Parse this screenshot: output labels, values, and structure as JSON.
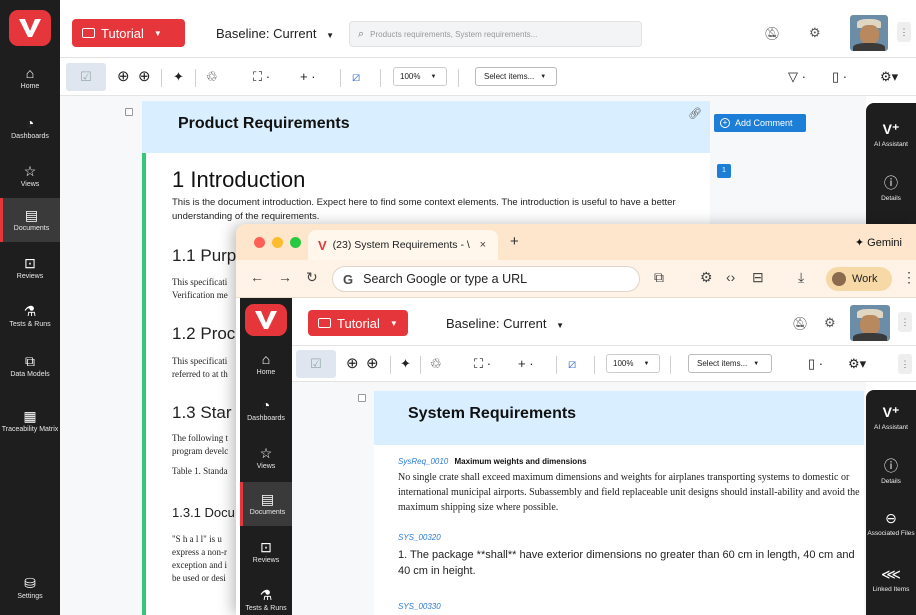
{
  "back": {
    "sidebar": [
      {
        "icon": "home-icon",
        "glyph": "⌂",
        "label": "Home"
      },
      {
        "icon": "dashboards-icon",
        "glyph": "◔",
        "label": "Dashboards"
      },
      {
        "icon": "views-icon",
        "glyph": "☆",
        "label": "Views"
      },
      {
        "icon": "documents-icon",
        "glyph": "▤",
        "label": "Documents"
      },
      {
        "icon": "reviews-icon",
        "glyph": "⊡",
        "label": "Reviews"
      },
      {
        "icon": "tests-icon",
        "glyph": "⚗",
        "label": "Tests & Runs"
      },
      {
        "icon": "data-models-icon",
        "glyph": "⧉",
        "label": "Data Models"
      },
      {
        "icon": "traceability-icon",
        "glyph": "▦",
        "label": "Traceability Matrix"
      },
      {
        "icon": "settings-icon",
        "glyph": "⛁",
        "label": "Settings"
      }
    ],
    "top": {
      "project_label": "Tutorial",
      "baseline_label": "Baseline: Current",
      "search_placeholder": "Products requirements, System requirements..."
    },
    "toolbar": {
      "zoom": "100%",
      "select_items": "Select items..."
    },
    "document": {
      "title": "Product Requirements",
      "add_comment": "Add Comment",
      "comment_count": "1",
      "h1": "1  Introduction",
      "intro": "This is the document introduction. Expect here to find some context elements. The introduction is useful to have a better understanding of the requirements.",
      "h2_purpose": "1.1  Purp",
      "purpose_text_1": "This specificati",
      "purpose_text_2": "Verification me",
      "h2_product": "1.2  Proc",
      "product_text_1": "This specificati",
      "product_text_2": "referred to at th",
      "h2_standards": "1.3  Star",
      "standards_text_1": "The following t",
      "standards_text_2": "program develc",
      "table_caption": "Table 1. Standa",
      "h3_doc": "1.3.1  Docu",
      "shall_text_1": "\"S h a l l\" is u",
      "shall_text_2": "express a non-r",
      "shall_text_3": "exception and i",
      "shall_text_4": "be used or desi"
    },
    "right_panel": [
      {
        "icon": "ai-assistant-icon",
        "glyph": "V⁺",
        "label": "AI Assistant"
      },
      {
        "icon": "details-icon",
        "glyph": "ⓘ",
        "label": "Details"
      }
    ]
  },
  "browser": {
    "tab_title": "(23) System Requirements - \\",
    "tab_close": "×",
    "new_tab": "+",
    "gemini": "✦ Gemini",
    "omnibox": "Search Google or type a URL",
    "profile": "Work",
    "app": {
      "sidebar": [
        {
          "icon": "home-icon",
          "glyph": "⌂",
          "label": "Home"
        },
        {
          "icon": "dashboards-icon",
          "glyph": "◔",
          "label": "Dashboards"
        },
        {
          "icon": "views-icon",
          "glyph": "☆",
          "label": "Views"
        },
        {
          "icon": "documents-icon",
          "glyph": "▤",
          "label": "Documents"
        },
        {
          "icon": "reviews-icon",
          "glyph": "⊡",
          "label": "Reviews"
        },
        {
          "icon": "tests-icon",
          "glyph": "⚗",
          "label": "Tests & Runs"
        }
      ],
      "top": {
        "project_label": "Tutorial",
        "baseline_label": "Baseline: Current"
      },
      "toolbar": {
        "zoom": "100%",
        "select_items": "Select items..."
      },
      "document": {
        "title": "System Requirements",
        "req1_id": "SysReq_0010",
        "req1_name": "Maximum weights and dimensions",
        "req1_text": "No single crate shall exceed maximum dimensions and weights for airplanes transporting systems to domestic or international municipal airports.  Subassembly and field replaceable unit designs should install-ability and avoid the maximum shipping size where possible.",
        "req2_id": "SYS_00320",
        "req2_text": "1. The package **shall** have exterior dimensions no greater than 60 cm in length, 40 cm and 40 cm in height.",
        "req3_id": "SYS_00330"
      },
      "right_panel": [
        {
          "icon": "ai-assistant-icon",
          "glyph": "V⁺",
          "label": "AI Assistant"
        },
        {
          "icon": "details-icon",
          "glyph": "ⓘ",
          "label": "Details"
        },
        {
          "icon": "attachment-icon",
          "glyph": "⊖",
          "label": "Associated Files"
        },
        {
          "icon": "linked-items-icon",
          "glyph": "⋘",
          "label": "Linked Items"
        }
      ]
    }
  },
  "colors": {
    "brand_red": "#e5373b",
    "accent_blue": "#1c7ed6",
    "sidebar_dark": "#1e1e1e",
    "status_green": "#34c77b",
    "header_blue": "#d9efff"
  }
}
